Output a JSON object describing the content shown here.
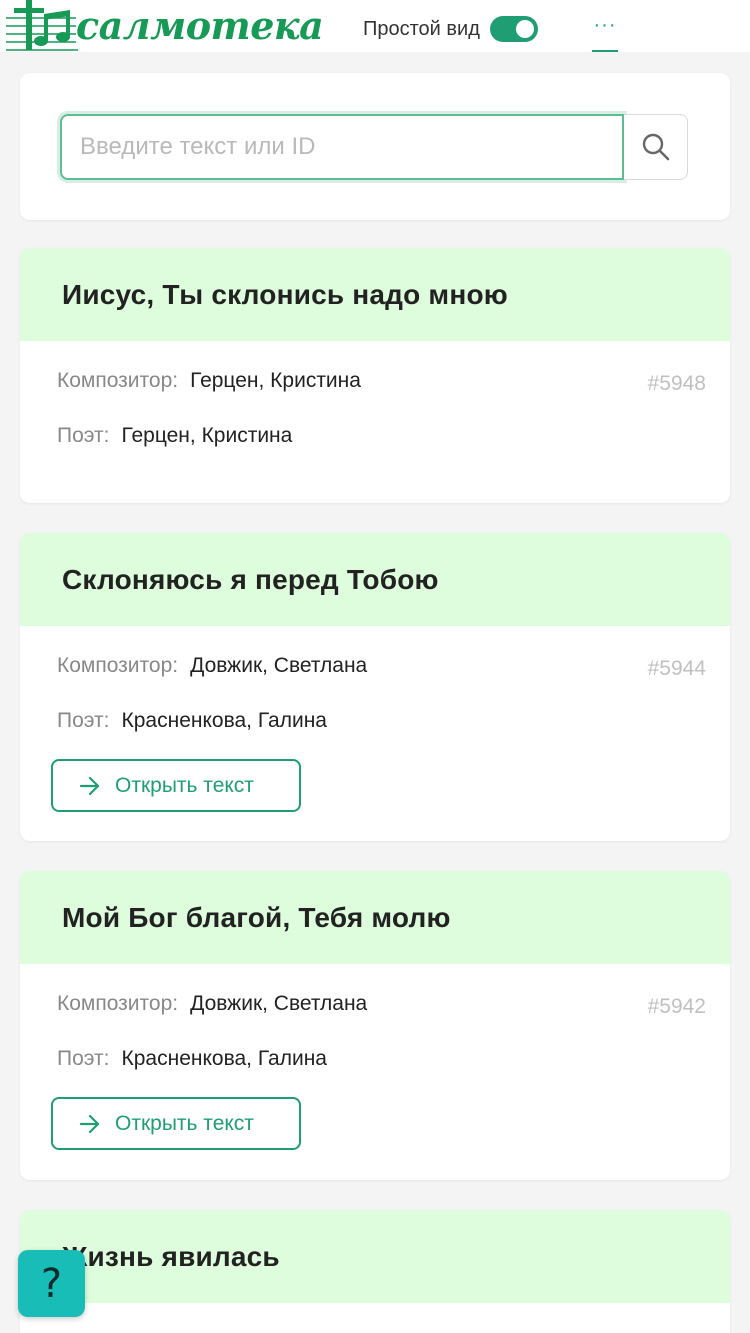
{
  "header": {
    "logo_text": "салмотека",
    "logo_full": "Псалмотека",
    "simple_view_label": "Простой вид",
    "simple_view_on": true,
    "more_label": "···"
  },
  "search": {
    "placeholder": "Введите текст или ID",
    "value": ""
  },
  "labels": {
    "composer": "Композитор",
    "poet": "Поэт",
    "colon": ":",
    "open_text": "Открыть текст"
  },
  "songs": [
    {
      "title": "Иисус, Ты склонись надо мною",
      "composer": "Герцен, Кристина",
      "poet": "Герцен, Кристина",
      "id": "#5948",
      "has_text": false
    },
    {
      "title": "Склоняюсь я перед Тобою",
      "composer": "Довжик, Светлана",
      "poet": "Красненкова, Галина",
      "id": "#5944",
      "has_text": true
    },
    {
      "title": "Мой Бог благой, Тебя молю",
      "composer": "Довжик, Светлана",
      "poet": "Красненкова, Галина",
      "id": "#5942",
      "has_text": true
    },
    {
      "title": "Жизнь явилась"
    }
  ],
  "help": {
    "label": "?"
  },
  "colors": {
    "brand_green": "#169a55",
    "accent_teal": "#1f9e73",
    "title_bar_bg": "#ddfddd",
    "help_bg": "#17bdb6",
    "page_bg": "#f4f4f4"
  }
}
